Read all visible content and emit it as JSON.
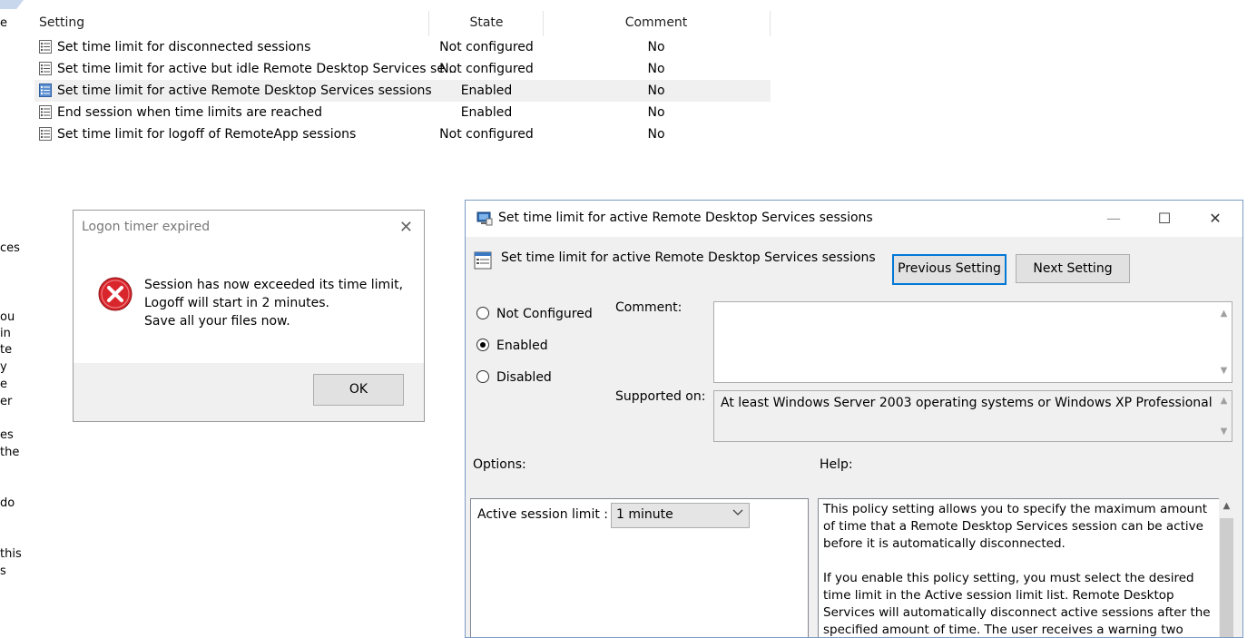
{
  "left_pane_fragments": [
    "e",
    "ces",
    "ou",
    "in",
    "te",
    "y",
    "e",
    "er",
    "es",
    "the",
    "do",
    "this",
    "s"
  ],
  "policy_list": {
    "columns": {
      "setting": "Setting",
      "state": "State",
      "comment": "Comment"
    },
    "rows": [
      {
        "name": "Set time limit for disconnected sessions",
        "state": "Not configured",
        "comment": "No"
      },
      {
        "name": "Set time limit for active but idle Remote Desktop Services se...",
        "state": "Not configured",
        "comment": "No"
      },
      {
        "name": "Set time limit for active Remote Desktop Services sessions",
        "state": "Enabled",
        "comment": "No",
        "selected": true
      },
      {
        "name": "End session when time limits are reached",
        "state": "Enabled",
        "comment": "No"
      },
      {
        "name": "Set time limit for logoff of RemoteApp sessions",
        "state": "Not configured",
        "comment": "No"
      }
    ]
  },
  "message_box": {
    "title": "Logon timer expired",
    "close_glyph": "✕",
    "lines": [
      "Session has now exceeded its time limit,",
      "Logoff will start in 2 minutes.",
      "Save all your files now."
    ],
    "ok_label": "OK",
    "icon": "error-icon"
  },
  "policy_dialog": {
    "window_title": "Set time limit for active Remote Desktop Services sessions",
    "minimize_glyph": "—",
    "maximize_glyph": "☐",
    "close_glyph": "✕",
    "setting_title": "Set time limit for active Remote Desktop Services sessions",
    "previous_label": "Previous Setting",
    "next_label": "Next Setting",
    "radio_options": [
      {
        "label": "Not Configured",
        "checked": false
      },
      {
        "label": "Enabled",
        "checked": true
      },
      {
        "label": "Disabled",
        "checked": false
      }
    ],
    "comment_label": "Comment:",
    "comment_value": "",
    "supported_label": "Supported on:",
    "supported_value": "At least Windows Server 2003 operating systems or Windows XP Professional",
    "options_label": "Options:",
    "help_label": "Help:",
    "active_session_limit_label": "Active session limit :",
    "active_session_limit_value": "1 minute",
    "help_paragraphs": [
      "This policy setting allows you to specify the maximum amount of time that a Remote Desktop Services session can be active before it is automatically disconnected.",
      "If you enable this policy setting, you must select the desired time limit in the Active session limit list. Remote Desktop Services will automatically disconnect active sessions after the specified amount of time. The user receives a warning two minutes before"
    ]
  },
  "colors": {
    "focus_border": "#0078d7",
    "dialog_bg": "#f0f0f0",
    "error_red": "#d9262c"
  }
}
